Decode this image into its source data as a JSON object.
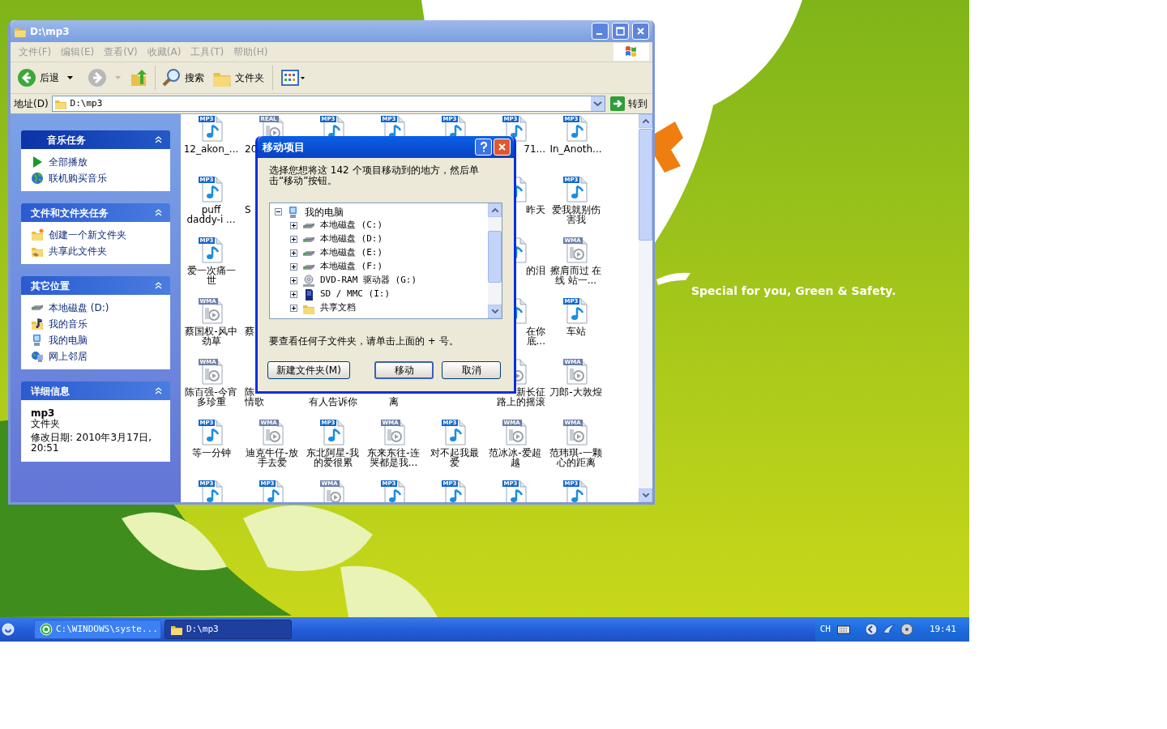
{
  "wallpaper": {
    "slogan": "Special for you, Green & Safety."
  },
  "window": {
    "title": "D:\\mp3",
    "active": false
  },
  "menu": [
    "文件(F)",
    "编辑(E)",
    "查看(V)",
    "收藏(A)",
    "工具(T)",
    "帮助(H)"
  ],
  "toolbar": {
    "back": "后退",
    "forward_enabled": false,
    "search": "搜索",
    "folders": "文件夹"
  },
  "address": {
    "label": "地址(D)",
    "value": "D:\\mp3",
    "go": "转到"
  },
  "task_panels": [
    {
      "kind": "special",
      "title": "音乐任务",
      "expanded": true,
      "items": [
        {
          "kind": "play",
          "label": "全部播放"
        },
        {
          "kind": "globe",
          "label": "联机购买音乐"
        }
      ]
    },
    {
      "kind": "normal",
      "title": "文件和文件夹任务",
      "expanded": true,
      "items": [
        {
          "kind": "new-folder",
          "label": "创建一个新文件夹"
        },
        {
          "kind": "share-folder",
          "label": "共享此文件夹"
        }
      ]
    },
    {
      "kind": "normal",
      "title": "其它位置",
      "expanded": true,
      "items": [
        {
          "kind": "drive",
          "label": "本地磁盘 (D:)"
        },
        {
          "kind": "music-folder",
          "label": "我的音乐"
        },
        {
          "kind": "computer",
          "label": "我的电脑"
        },
        {
          "kind": "network",
          "label": "网上邻居"
        }
      ]
    },
    {
      "kind": "details",
      "title": "详细信息",
      "expanded": true,
      "name": "mp3",
      "type": "文件夹",
      "modified": "修改日期: 2010年3月17日, 20:51"
    }
  ],
  "files": [
    {
      "before_dialog": [
        {
          "kind": "mp3",
          "badge": "MP3",
          "lines": [
            "12_akon_..."
          ]
        },
        {
          "kind": "real",
          "badge": "REAL",
          "lines": [
            "20"
          ]
        },
        {
          "kind": "mp3",
          "badge": "MP3"
        },
        {
          "kind": "mp3",
          "badge": "MP3"
        },
        {
          "kind": "mp3",
          "badge": "MP3"
        }
      ],
      "after_dialog": [
        {
          "kind": "mp3",
          "badge": "MP3",
          "lines": [
            "71..."
          ]
        },
        {
          "kind": "mp3",
          "badge": "MP3",
          "lines": [
            "In_Anoth..."
          ]
        }
      ]
    },
    {
      "before_dialog": [
        {
          "kind": "mp3",
          "badge": "MP3",
          "lines": [
            "puff",
            "daddy-i ..."
          ]
        },
        {
          "lines": [
            "S"
          ]
        }
      ],
      "after_dialog": [
        {
          "kind": "mp3",
          "lines": [
            "昨天"
          ]
        },
        {
          "kind": "mp3",
          "badge": "MP3",
          "lines": [
            "爱我就别伤害我"
          ]
        }
      ]
    },
    {
      "before_dialog": [
        {
          "kind": "mp3",
          "badge": "MP3",
          "lines": [
            "爱一次痛一世"
          ]
        }
      ],
      "after_dialog": [
        {
          "kind": "mp3",
          "lines": [
            "的泪"
          ]
        },
        {
          "kind": "wma",
          "badge": "WMA",
          "lines": [
            "擦肩而过 在线 站一..."
          ]
        }
      ]
    },
    {
      "before_dialog": [
        {
          "kind": "wma",
          "badge": "WMA",
          "lines": [
            "蔡国权-风中劲草"
          ]
        },
        {
          "lines": [
            "蔡"
          ]
        }
      ],
      "after_dialog": [
        {
          "kind": "mp3",
          "lines": [
            "在你",
            "底..."
          ]
        },
        {
          "kind": "mp3",
          "badge": "MP3",
          "lines": [
            "车站"
          ]
        }
      ]
    },
    {
      "before_dialog": [
        {
          "kind": "wma",
          "badge": "WMA",
          "lines": [
            "陈百强-今宵多珍重"
          ]
        },
        {
          "lines": [
            "陈",
            "情歌"
          ]
        },
        {
          "lines": [
            "有人告诉你"
          ]
        },
        {
          "lines": [
            "离"
          ]
        }
      ],
      "after_dialog": [
        {
          "kind": "wma",
          "lines": [
            "新长征",
            "路上的摇滚"
          ]
        },
        {
          "kind": "wma",
          "badge": "WMA",
          "lines": [
            "刀郎-大敦煌"
          ]
        }
      ]
    },
    {
      "before_dialog": [
        {
          "kind": "mp3",
          "badge": "MP3",
          "lines": [
            "等一分钟"
          ]
        },
        {
          "kind": "wma",
          "badge": "WMA",
          "lines": [
            "迪克牛仔-放手去爱"
          ]
        },
        {
          "kind": "mp3",
          "badge": "MP3",
          "lines": [
            "东北阿星-我的爱很累"
          ]
        },
        {
          "kind": "wma",
          "badge": "WMA",
          "lines": [
            "东来东往-连哭都是我..."
          ]
        },
        {
          "kind": "mp3",
          "badge": "MP3",
          "lines": [
            "对不起我最爱"
          ]
        },
        {
          "kind": "wma",
          "badge": "WMA",
          "lines": [
            "范冰冰-爱超越"
          ]
        },
        {
          "kind": "wma",
          "badge": "WMA",
          "lines": [
            "范玮琪-一颗心的距离"
          ]
        }
      ]
    },
    {
      "before_dialog": [
        {
          "kind": "mp3",
          "badge": "MP3"
        },
        {
          "kind": "mp3",
          "badge": "MP3"
        },
        {
          "kind": "wma",
          "badge": "WMA"
        },
        {
          "kind": "mp3",
          "badge": "MP3"
        },
        {
          "kind": "mp3",
          "badge": "MP3"
        },
        {
          "kind": "mp3",
          "badge": "MP3"
        },
        {
          "kind": "mp3",
          "badge": "MP3"
        }
      ]
    }
  ],
  "dialog": {
    "title": "移动项目",
    "prompt": "选择您想将这 142 个项目移动到的地方，然后单击“移动”按钮。",
    "tree": {
      "kind": "computer",
      "label": "我的电脑",
      "expanded": true,
      "children": [
        {
          "kind": "drive",
          "label": "本地磁盘 (C:)",
          "expanded": false
        },
        {
          "kind": "drive",
          "label": "本地磁盘 (D:)",
          "expanded": false
        },
        {
          "kind": "drive",
          "label": "本地磁盘 (E:)",
          "expanded": false
        },
        {
          "kind": "drive",
          "label": "本地磁盘 (F:)",
          "expanded": false
        },
        {
          "kind": "dvd",
          "label": "DVD-RAM 驱动器 (G:)",
          "expanded": false
        },
        {
          "kind": "card",
          "label": "SD / MMC (I:)",
          "expanded": false
        },
        {
          "kind": "folder",
          "label": "共享文档",
          "expanded": false
        }
      ]
    },
    "hint": "要查看任何子文件夹，请单击上面的 + 号。",
    "buttons": [
      {
        "label": "新建文件夹(M)",
        "default": false
      },
      {
        "label": "移动",
        "default": true
      },
      {
        "label": "取消",
        "default": false
      }
    ]
  },
  "taskbar": {
    "tasks": [
      {
        "kind": "browser",
        "label": "C:\\WINDOWS\\syste...",
        "selected": false
      },
      {
        "kind": "folder",
        "label": "D:\\mp3",
        "selected": true
      }
    ],
    "language": "CH",
    "clock": "19:41"
  }
}
